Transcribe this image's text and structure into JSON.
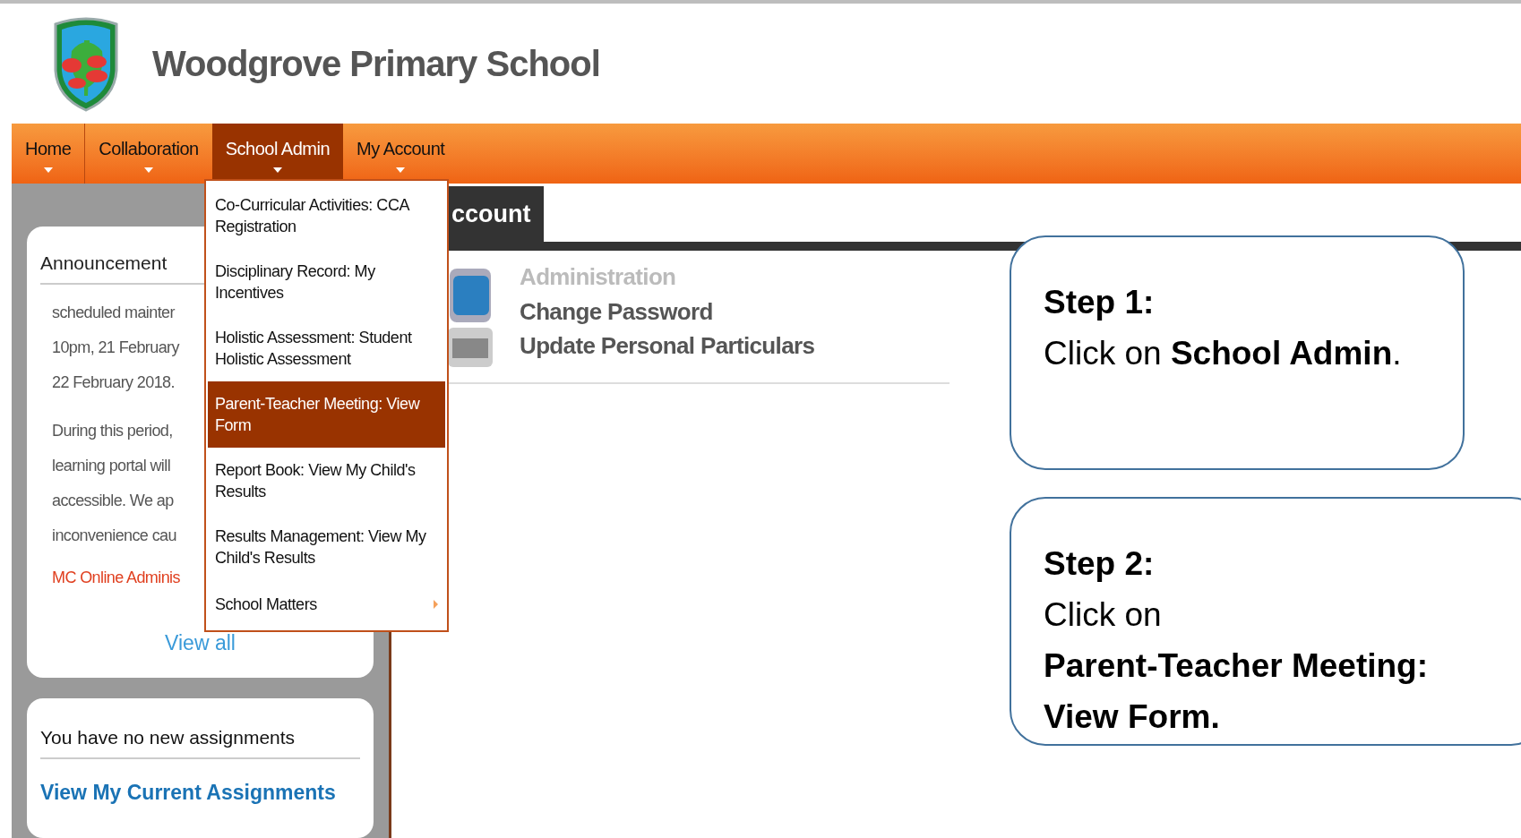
{
  "header": {
    "school_name": "Woodgrove Primary School"
  },
  "nav": [
    {
      "label": "Home",
      "selected": false
    },
    {
      "label": "Collaboration",
      "selected": false
    },
    {
      "label": "School Admin",
      "selected": true
    },
    {
      "label": "My Account",
      "selected": false
    }
  ],
  "dropdown": [
    {
      "label": "Co-Curricular Activities: CCA Registration",
      "selected": false,
      "has_submenu": false
    },
    {
      "label": "Disciplinary Record: My Incentives",
      "selected": false,
      "has_submenu": false
    },
    {
      "label": "Holistic Assessment: Student Holistic Assessment",
      "selected": false,
      "has_submenu": false
    },
    {
      "label": "Parent-Teacher Meeting: View Form",
      "selected": true,
      "has_submenu": false
    },
    {
      "label": "Report Book: View My Child's Results",
      "selected": false,
      "has_submenu": false
    },
    {
      "label": "Results Management: View My Child's Results",
      "selected": false,
      "has_submenu": false
    },
    {
      "label": "School Matters",
      "selected": false,
      "has_submenu": true
    }
  ],
  "announcement": {
    "title": "Announcement",
    "paragraphs": [
      [
        "scheduled mainter",
        "10pm, 21 February",
        "22 February 2018."
      ],
      [
        "During this period,",
        "learning portal will",
        "accessible. We ap",
        "inconvenience cau"
      ]
    ],
    "signature": "MC Online Adminis",
    "view_all": "View all"
  },
  "assignments": {
    "title": "You have no new assignments",
    "link": "View My Current Assignments"
  },
  "main": {
    "tab": "ccount",
    "section_title": "Administration",
    "links": [
      "Change Password",
      "Update Personal Particulars"
    ]
  },
  "callouts": [
    {
      "title": "Step 1:",
      "lines": [
        "Click on **School Admin**."
      ]
    },
    {
      "title": "Step 2:",
      "lines": [
        "Click on",
        "**Parent-Teacher Meeting:**",
        "**View Form.**"
      ]
    }
  ]
}
